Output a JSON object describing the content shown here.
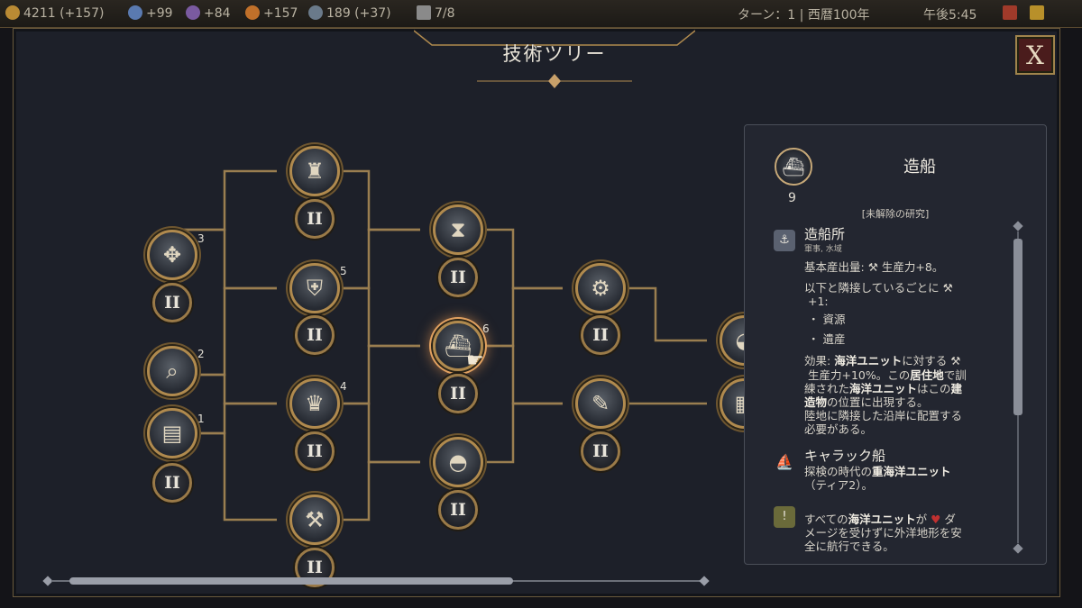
{
  "topbar": {
    "gold": "4211 (+157)",
    "science": "+99",
    "culture": "+84",
    "happiness": "+157",
    "influence": "189 (+37)",
    "units": "7/8",
    "turn": "ターン：1 | 西暦100年",
    "clock": "午後5:45"
  },
  "window": {
    "title": "技術ツリー",
    "close_label": "X"
  },
  "tree": {
    "level_label": "II",
    "numbers": {
      "n3": "3",
      "n2": "2",
      "n1": "1",
      "n5": "5",
      "n4": "4",
      "n6": "6"
    }
  },
  "info": {
    "tech_name": "造船",
    "cost": "9",
    "status": "[未解除の研究]",
    "building": {
      "name": "造船所",
      "tags": "軍事, 水域",
      "base_output": "基本産出量:",
      "base_value": "生産力+8。",
      "adjacency_1": "以下と隣接しているごとに",
      "adjacency_2": "+1:",
      "bullet_1": "・ 資源",
      "bullet_2": "・ 遺産",
      "effect_prefix": "効果:",
      "effect_unit": "海洋ユニット",
      "effect_text_1": "に対する",
      "effect_text_2": "生産力+10%。この",
      "effect_settlement": "居住地",
      "effect_text_3": "で訓",
      "effect_text_4": "練された",
      "effect_unit2": "海洋ユニット",
      "effect_text_5": "はこの",
      "effect_build": "建",
      "effect_build2": "造物",
      "effect_text_6": "の位置に出現する。",
      "effect_text_7": "陸地に隣接した沿岸に配置する",
      "effect_text_8": "必要がある。"
    },
    "unit": {
      "name": "キャラック船",
      "desc_prefix": "探検の時代の",
      "desc_bold": "重海洋ユニット",
      "desc_suffix": "（ティア2）。"
    },
    "ability": {
      "prefix": "すべての",
      "bold": "海洋ユニット",
      "mid": "が",
      "line1_end": "ダ",
      "line2": "メージを受けずに外洋地形を安",
      "line3": "全に航行できる。"
    }
  },
  "colors": {
    "gold_border": "#b08a4e",
    "line": "#9a7e50",
    "panel": "#1d2029",
    "close_bg": "#4a1c1c"
  }
}
